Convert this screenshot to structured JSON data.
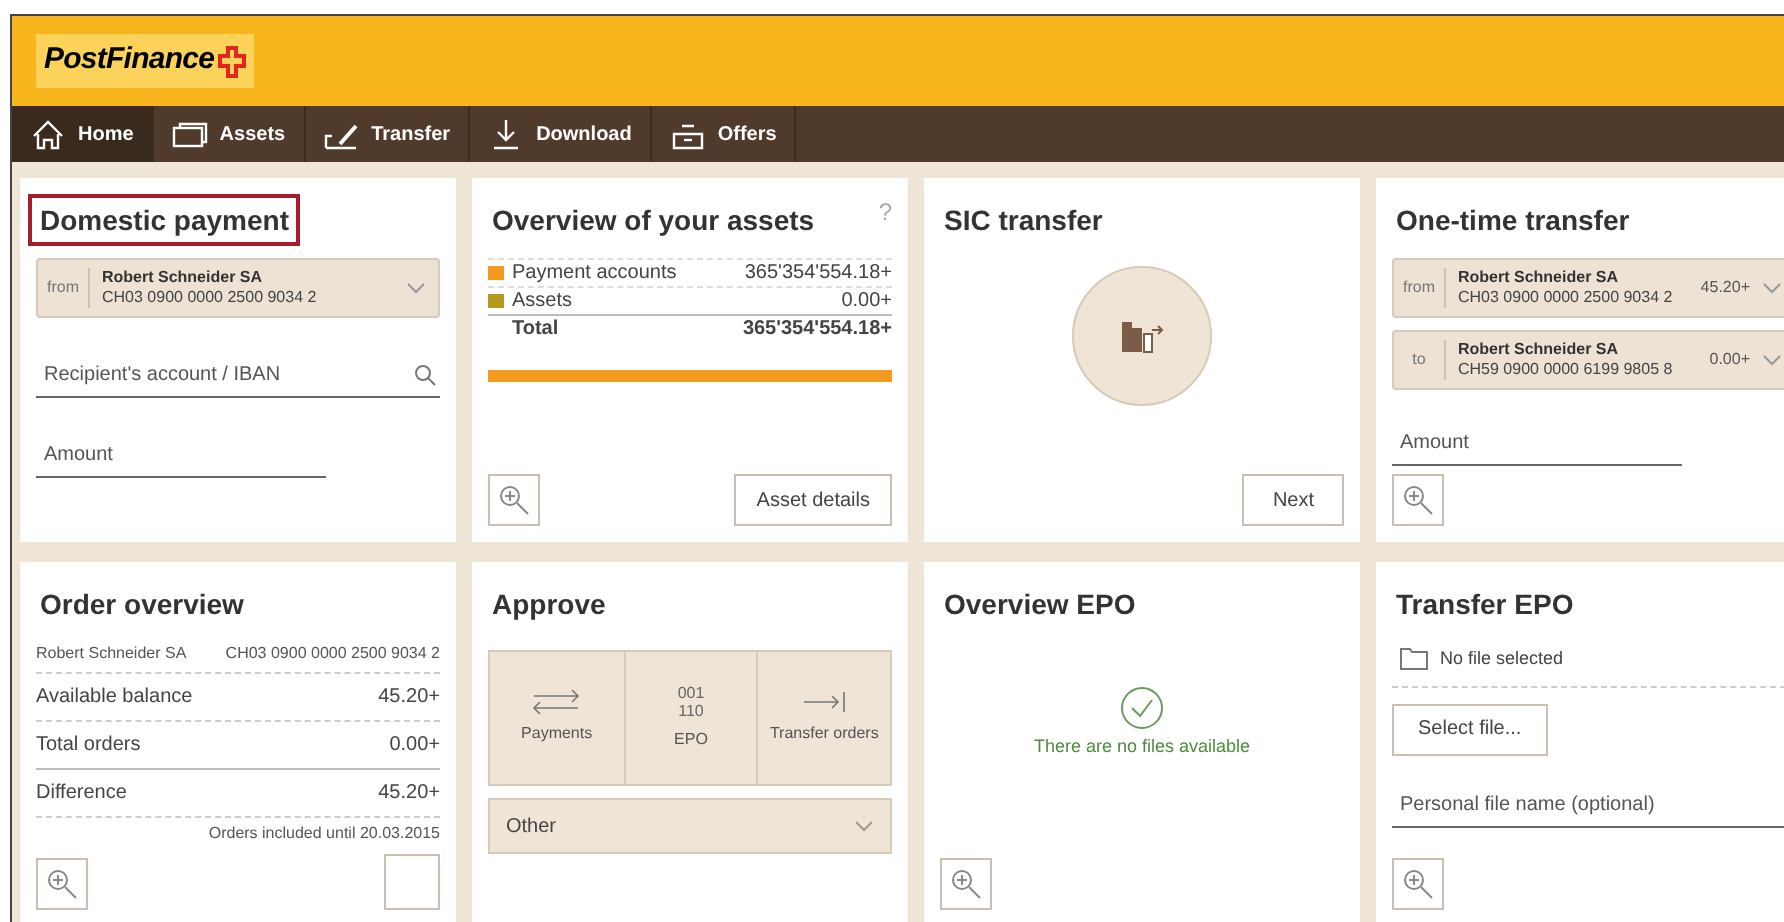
{
  "header": {
    "logo": "PostFinance"
  },
  "nav": [
    {
      "label": "Home",
      "kind": "home",
      "selected": true
    },
    {
      "label": "Assets",
      "kind": "assets",
      "selected": false
    },
    {
      "label": "Transfer",
      "kind": "transfer",
      "selected": false
    },
    {
      "label": "Download",
      "kind": "download",
      "selected": false
    },
    {
      "label": "Offers",
      "kind": "offers",
      "selected": false
    }
  ],
  "cards": [
    {
      "kind": "domestic",
      "title": "Domestic payment",
      "highlighted": true,
      "account": {
        "prefix": "from",
        "name": "Robert Schneider SA",
        "iban": "CH03 0900 0000 2500 9034 2"
      },
      "recipient_placeholder": "Recipient's account / IBAN",
      "amount_placeholder": "Amount"
    },
    {
      "kind": "assets",
      "title": "Overview of your assets",
      "highlighted": false,
      "help": "?",
      "rows": [
        {
          "label": "Payment accounts",
          "value": "365'354'554.18+",
          "color": "#f39a1f"
        },
        {
          "label": "Assets",
          "value": "0.00+",
          "color": "#b8991f"
        }
      ],
      "total": {
        "label": "Total",
        "value": "365'354'554.18+"
      },
      "level": 1,
      "button": "Asset details"
    },
    {
      "kind": "sic",
      "title": "SIC transfer",
      "highlighted": false,
      "button": "Next"
    },
    {
      "kind": "onetime",
      "title": "One-time transfer",
      "highlighted": false,
      "accounts": [
        {
          "prefix": "from",
          "name": "Robert Schneider SA",
          "iban": "CH03 0900 0000 2500 9034 2",
          "amount": "45.20+"
        },
        {
          "prefix": "to",
          "name": "Robert Schneider SA",
          "iban": "CH59 0900 0000 6199 9805 8",
          "amount": "0.00+"
        }
      ],
      "amount_placeholder": "Amount"
    },
    {
      "kind": "orders",
      "title": "Order overview",
      "highlighted": false,
      "account_name": "Robert Schneider SA",
      "account_iban": "CH03 0900 0000 2500 9034 2",
      "rows": [
        {
          "label": "Available balance",
          "value": "45.20+"
        },
        {
          "label": "Total orders",
          "value": "0.00+"
        },
        {
          "label": "Difference",
          "value": "45.20+"
        }
      ],
      "note": "Orders included until 20.03.2015"
    },
    {
      "kind": "approve",
      "title": "Approve",
      "highlighted": false,
      "tiles": [
        {
          "kind": "arrows",
          "label": "Payments"
        },
        {
          "kind": "code",
          "code": [
            "001",
            "110"
          ],
          "label": "EPO"
        },
        {
          "kind": "arrow-bar",
          "label": "Transfer orders"
        }
      ],
      "dropdown": "Other"
    },
    {
      "kind": "epo_overview",
      "title": "Overview EPO",
      "highlighted": false,
      "message": "There are no files available"
    },
    {
      "kind": "epo_transfer",
      "title": "Transfer EPO",
      "highlighted": false,
      "file_status": "No file selected",
      "button": "Select file...",
      "name_placeholder": "Personal file name (optional)"
    }
  ]
}
